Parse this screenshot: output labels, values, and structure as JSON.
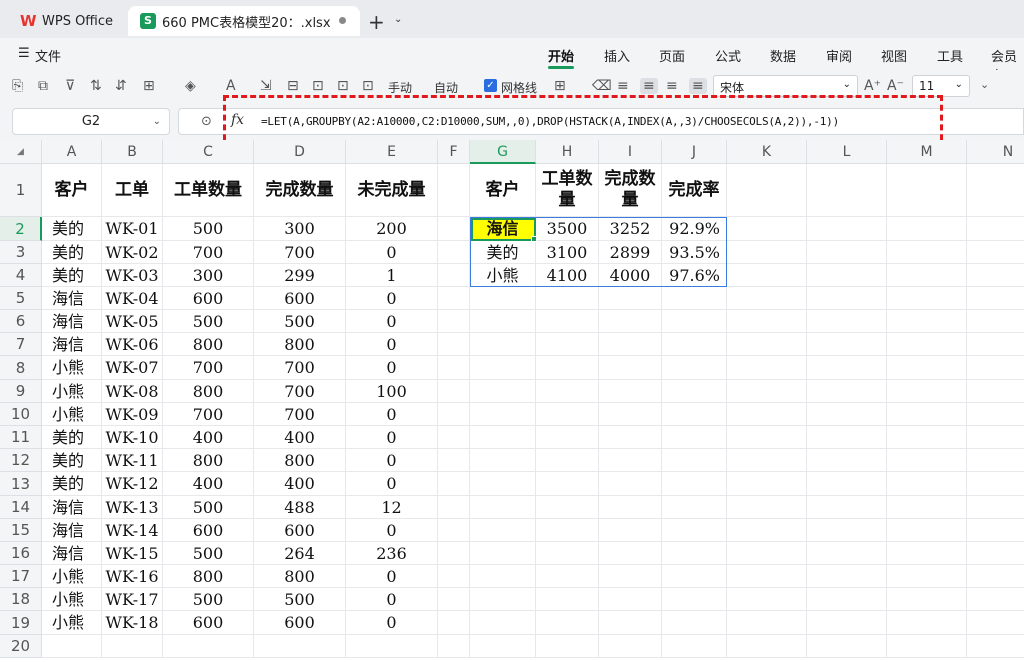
{
  "titlebar": {
    "app_tab": "WPS Office",
    "file_tab": "660 PMC表格模型20：.xlsx",
    "new_tab": "+"
  },
  "menubar": {
    "file": "文件",
    "items": [
      "开始",
      "插入",
      "页面",
      "公式",
      "数据",
      "审阅",
      "视图",
      "工具",
      "会员专"
    ]
  },
  "toolbar": {
    "manual": "手动",
    "auto": "自动",
    "gridlines": "网格线",
    "gridlines_checked": true,
    "font_name": "宋体",
    "font_size": "11"
  },
  "formula_bar": {
    "name_box": "G2",
    "fx": "fx",
    "formula": "=LET(A,GROUPBY(A2:A10000,C2:D10000,SUM,,0),DROP(HSTACK(A,INDEX(A,,3)/CHOOSECOLS(A,2)),-1))"
  },
  "sheet": {
    "columns": [
      "A",
      "B",
      "C",
      "D",
      "E",
      "F",
      "G",
      "H",
      "I",
      "J",
      "K",
      "L",
      "M",
      "N"
    ],
    "selected_column": "G",
    "selected_row": "2",
    "rows": [
      "1",
      "2",
      "3",
      "4",
      "5",
      "6",
      "7",
      "8",
      "9",
      "10",
      "11",
      "12",
      "13",
      "14",
      "15",
      "16",
      "17",
      "18",
      "19",
      "20"
    ],
    "headers": [
      "客户",
      "工单",
      "工单数量",
      "完成数量",
      "未完成量"
    ],
    "data": [
      [
        "美的",
        "WK-01",
        "500",
        "300",
        "200"
      ],
      [
        "美的",
        "WK-02",
        "700",
        "700",
        "0"
      ],
      [
        "美的",
        "WK-03",
        "300",
        "299",
        "1"
      ],
      [
        "海信",
        "WK-04",
        "600",
        "600",
        "0"
      ],
      [
        "海信",
        "WK-05",
        "500",
        "500",
        "0"
      ],
      [
        "海信",
        "WK-06",
        "800",
        "800",
        "0"
      ],
      [
        "小熊",
        "WK-07",
        "700",
        "700",
        "0"
      ],
      [
        "小熊",
        "WK-08",
        "800",
        "700",
        "100"
      ],
      [
        "小熊",
        "WK-09",
        "700",
        "700",
        "0"
      ],
      [
        "美的",
        "WK-10",
        "400",
        "400",
        "0"
      ],
      [
        "美的",
        "WK-11",
        "800",
        "800",
        "0"
      ],
      [
        "美的",
        "WK-12",
        "400",
        "400",
        "0"
      ],
      [
        "海信",
        "WK-13",
        "500",
        "488",
        "12"
      ],
      [
        "海信",
        "WK-14",
        "600",
        "600",
        "0"
      ],
      [
        "海信",
        "WK-15",
        "500",
        "264",
        "236"
      ],
      [
        "小熊",
        "WK-16",
        "800",
        "800",
        "0"
      ],
      [
        "小熊",
        "WK-17",
        "500",
        "500",
        "0"
      ],
      [
        "小熊",
        "WK-18",
        "600",
        "600",
        "0"
      ]
    ],
    "summary_headers": [
      "客户",
      "工单数\n量",
      "完成数\n量",
      "完成率"
    ],
    "summary": [
      [
        "海信",
        "3500",
        "3252",
        "92.9%"
      ],
      [
        "美的",
        "3100",
        "2899",
        "93.5%"
      ],
      [
        "小熊",
        "4100",
        "4000",
        "97.6%"
      ]
    ],
    "highlight_color": "#ffff00",
    "accent_color": "#1a9a5a",
    "annotation_color": "#e0191d"
  }
}
